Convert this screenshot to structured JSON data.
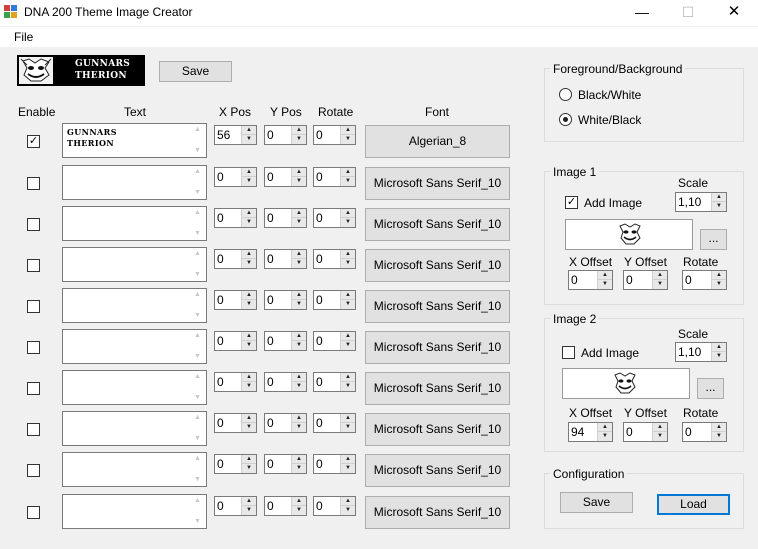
{
  "window": {
    "title": "DNA 200 Theme Image Creator",
    "minimize_glyph": "—",
    "maximize_glyph": "☐",
    "close_glyph": "✕"
  },
  "menu": {
    "file": "File"
  },
  "preview": {
    "line1": "GUNNARS",
    "line2": "THERION"
  },
  "toolbar": {
    "save": "Save"
  },
  "headers": {
    "enable": "Enable",
    "text": "Text",
    "xpos": "X Pos",
    "ypos": "Y Pos",
    "rotate": "Rotate",
    "font": "Font"
  },
  "rows": [
    {
      "enabled": true,
      "text_line1": "GUNNARS",
      "text_line2": "THERION",
      "x": "56",
      "y": "0",
      "rotate": "0",
      "font": "Algerian_8"
    },
    {
      "enabled": false,
      "text_line1": "",
      "text_line2": "",
      "x": "0",
      "y": "0",
      "rotate": "0",
      "font": "Microsoft Sans Serif_10"
    },
    {
      "enabled": false,
      "text_line1": "",
      "text_line2": "",
      "x": "0",
      "y": "0",
      "rotate": "0",
      "font": "Microsoft Sans Serif_10"
    },
    {
      "enabled": false,
      "text_line1": "",
      "text_line2": "",
      "x": "0",
      "y": "0",
      "rotate": "0",
      "font": "Microsoft Sans Serif_10"
    },
    {
      "enabled": false,
      "text_line1": "",
      "text_line2": "",
      "x": "0",
      "y": "0",
      "rotate": "0",
      "font": "Microsoft Sans Serif_10"
    },
    {
      "enabled": false,
      "text_line1": "",
      "text_line2": "",
      "x": "0",
      "y": "0",
      "rotate": "0",
      "font": "Microsoft Sans Serif_10"
    },
    {
      "enabled": false,
      "text_line1": "",
      "text_line2": "",
      "x": "0",
      "y": "0",
      "rotate": "0",
      "font": "Microsoft Sans Serif_10"
    },
    {
      "enabled": false,
      "text_line1": "",
      "text_line2": "",
      "x": "0",
      "y": "0",
      "rotate": "0",
      "font": "Microsoft Sans Serif_10"
    },
    {
      "enabled": false,
      "text_line1": "",
      "text_line2": "",
      "x": "0",
      "y": "0",
      "rotate": "0",
      "font": "Microsoft Sans Serif_10"
    },
    {
      "enabled": false,
      "text_line1": "",
      "text_line2": "",
      "x": "0",
      "y": "0",
      "rotate": "0",
      "font": "Microsoft Sans Serif_10"
    }
  ],
  "fgbg": {
    "title": "Foreground/Background",
    "option1": "Black/White",
    "option2": "White/Black",
    "selected": "White/Black"
  },
  "image1": {
    "title": "Image 1",
    "add_image_label": "Add Image",
    "add_image_checked": true,
    "scale_label": "Scale",
    "scale": "1,10",
    "browse": "...",
    "xoffset_label": "X Offset",
    "yoffset_label": "Y Offset",
    "rotate_label": "Rotate",
    "xoffset": "0",
    "yoffset": "0",
    "rotate": "0"
  },
  "image2": {
    "title": "Image 2",
    "add_image_label": "Add Image",
    "add_image_checked": false,
    "scale_label": "Scale",
    "scale": "1,10",
    "browse": "...",
    "xoffset_label": "X Offset",
    "yoffset_label": "Y Offset",
    "rotate_label": "Rotate",
    "xoffset": "94",
    "yoffset": "0",
    "rotate": "0"
  },
  "config": {
    "title": "Configuration",
    "save": "Save",
    "load": "Load"
  },
  "glyphs": {
    "check": "✓",
    "spin_up": "▲",
    "spin_down": "▼"
  }
}
